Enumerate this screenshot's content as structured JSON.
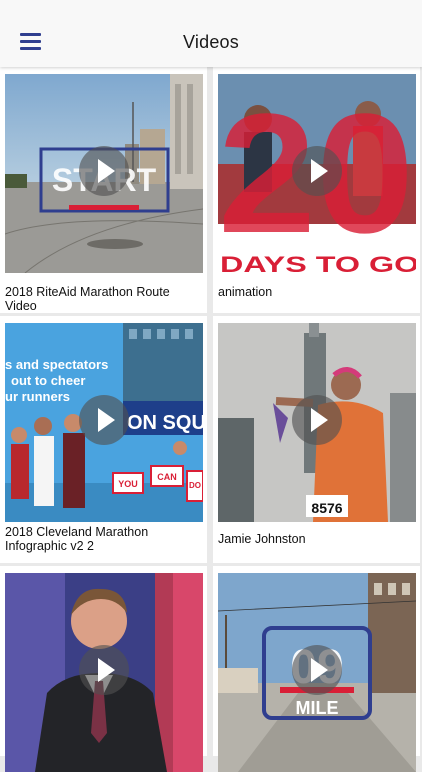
{
  "header": {
    "title": "Videos",
    "menu_icon": "hamburger-menu-icon"
  },
  "videos": [
    {
      "title": "2018 RiteAid Marathon Route Video",
      "thumbnail_text": "START"
    },
    {
      "title": "animation",
      "thumbnail_text": [
        "20",
        "DAYS TO GO!"
      ]
    },
    {
      "title": "2018 Cleveland Marathon Infographic v2 2",
      "thumbnail_text": [
        "s and spectators",
        "out to cheer",
        "ur runners",
        "ON SQU",
        "YOU",
        "CAN",
        "DO"
      ]
    },
    {
      "title": "Jamie Johnston",
      "thumbnail_text": "8576"
    },
    {
      "title": "",
      "thumbnail_text": ""
    },
    {
      "title": "",
      "thumbnail_text": [
        "09",
        "MILE"
      ]
    }
  ],
  "colors": {
    "accent": "#2f3e8f",
    "marathon_red": "#d91f36",
    "header_bg": "#f8f8f8",
    "page_bg": "#e9e9e9"
  }
}
